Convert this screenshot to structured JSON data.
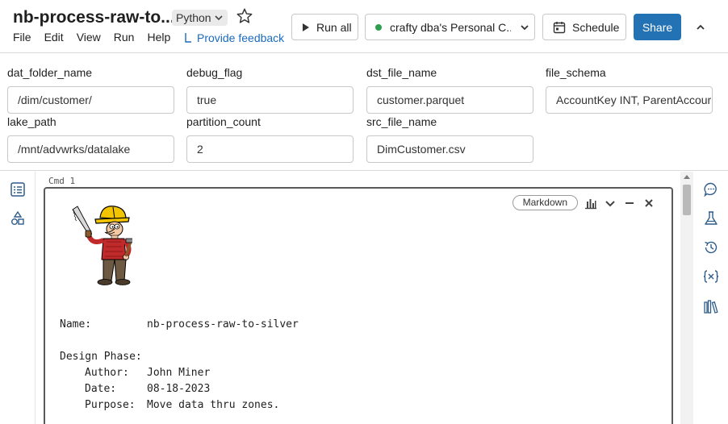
{
  "header": {
    "notebook_title": "nb-process-raw-to...",
    "language": "Python",
    "menu": [
      "File",
      "Edit",
      "View",
      "Run",
      "Help"
    ],
    "feedback_label": "Provide feedback",
    "run_all_label": "Run all",
    "cluster_label": "crafty dba's Personal C...",
    "schedule_label": "Schedule",
    "share_label": "Share",
    "accent_color": "#2272b4",
    "cluster_status_color": "#2e9e4f"
  },
  "widgets": [
    {
      "label": "dat_folder_name",
      "value": "/dim/customer/"
    },
    {
      "label": "debug_flag",
      "value": "true"
    },
    {
      "label": "dst_file_name",
      "value": "customer.parquet"
    },
    {
      "label": "file_schema",
      "value": "AccountKey INT, ParentAccour"
    },
    {
      "label": "lake_path",
      "value": "/mnt/advwrks/datalake"
    },
    {
      "label": "partition_count",
      "value": "2"
    },
    {
      "label": "src_file_name",
      "value": "DimCustomer.csv"
    }
  ],
  "cell": {
    "cmd_label": "Cmd 1",
    "type_badge": "Markdown",
    "lines": {
      "name_key": "Name:",
      "name_value": "nb-process-raw-to-silver",
      "phase": "Design Phase:",
      "author_key": "Author:",
      "author_value": "John Miner",
      "date_key": "Date:",
      "date_value": "08-18-2023",
      "purpose_key": "Purpose:",
      "purpose_value": "Move data thru zones."
    }
  },
  "icons": {
    "left_rail": [
      "table-of-contents-icon",
      "shapes-icon"
    ],
    "right_rail": [
      "comment-icon",
      "experiment-icon",
      "history-icon",
      "variables-icon",
      "library-icon"
    ]
  }
}
